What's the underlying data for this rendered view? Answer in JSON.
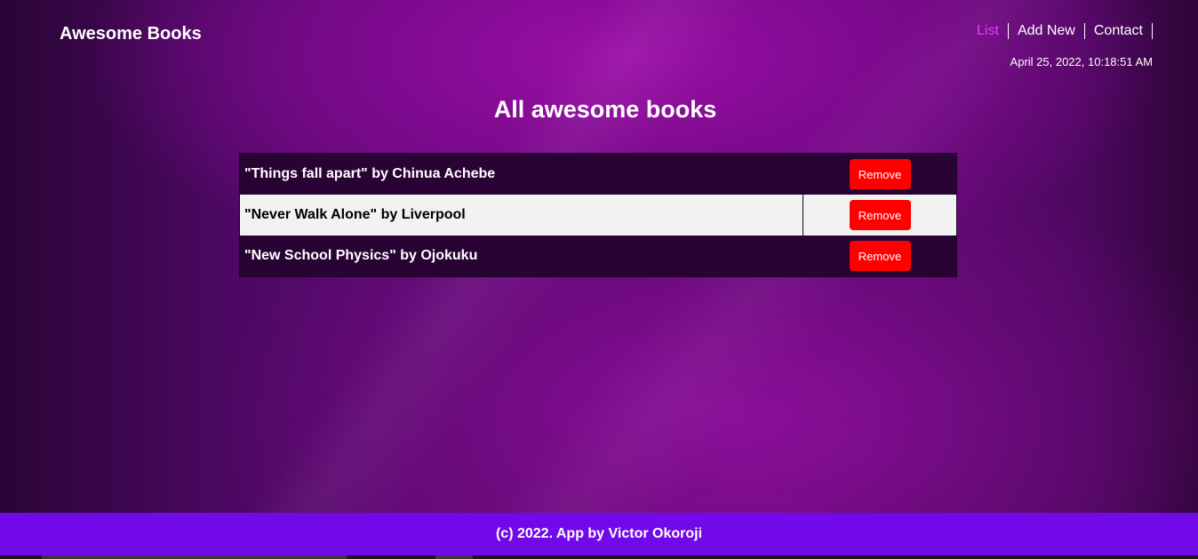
{
  "header": {
    "brand": "Awesome Books",
    "nav": [
      {
        "label": "List",
        "active": true
      },
      {
        "label": "Add New",
        "active": false
      },
      {
        "label": "Contact",
        "active": false
      }
    ],
    "datetime": "April 25, 2022, 10:18:51 AM"
  },
  "main": {
    "title": "All awesome books",
    "books": [
      {
        "text": "\"Things fall apart\" by Chinua Achebe",
        "button": "Remove"
      },
      {
        "text": "\"Never Walk Alone\" by Liverpool",
        "button": "Remove"
      },
      {
        "text": "\"New School Physics\" by Ojokuku",
        "button": "Remove"
      }
    ]
  },
  "footer": {
    "text": "(c) 2022. App by Victor Okoroji"
  },
  "colors": {
    "active_nav": "#e040fb",
    "remove_button": "#ff0000",
    "footer_bg": "#7209e8",
    "row_dark": "#2a0335",
    "row_light": "#f2f2f2"
  }
}
